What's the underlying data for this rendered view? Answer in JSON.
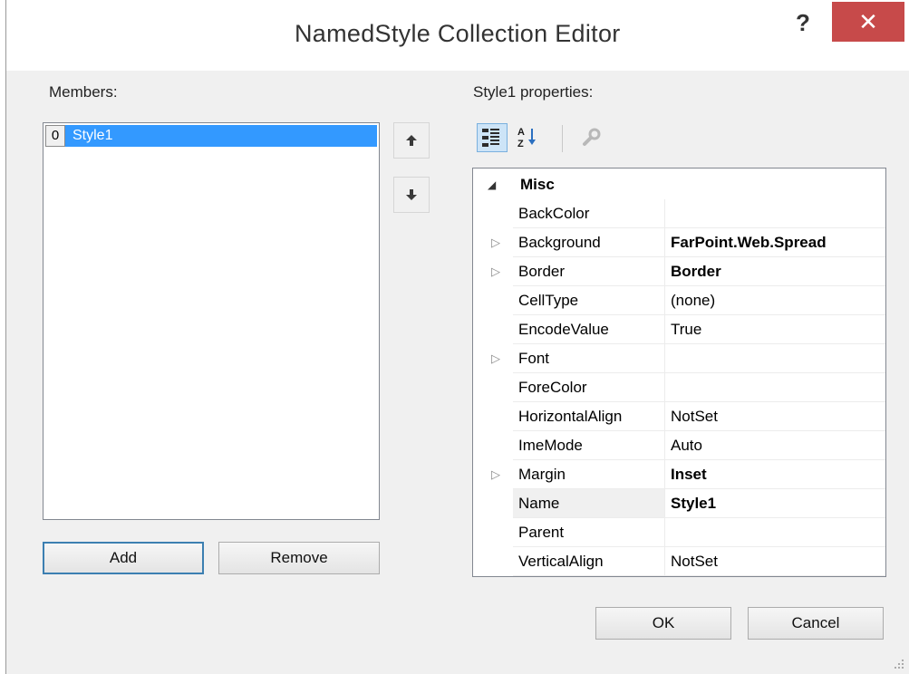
{
  "window": {
    "title": "NamedStyle Collection Editor",
    "help_label": "?",
    "close_label": "✕"
  },
  "members": {
    "label": "Members:",
    "items": [
      {
        "index": "0",
        "name": "Style1"
      }
    ],
    "add_label": "Add",
    "remove_label": "Remove",
    "move_up_icon": "arrow-up-icon",
    "move_down_icon": "arrow-down-icon"
  },
  "properties": {
    "label": "Style1 properties:",
    "toolbar": [
      "categorized-icon",
      "alphabetical-icon",
      "property-pages-icon"
    ],
    "category": "Misc",
    "rows": [
      {
        "name": "BackColor",
        "value": "",
        "bold": false,
        "expandable": false
      },
      {
        "name": "Background",
        "value": "FarPoint.Web.Spread",
        "bold": true,
        "expandable": true
      },
      {
        "name": "Border",
        "value": "Border",
        "bold": true,
        "expandable": true
      },
      {
        "name": "CellType",
        "value": "(none)",
        "bold": false,
        "expandable": false
      },
      {
        "name": "EncodeValue",
        "value": "True",
        "bold": false,
        "expandable": false
      },
      {
        "name": "Font",
        "value": "",
        "bold": false,
        "expandable": true
      },
      {
        "name": "ForeColor",
        "value": "",
        "bold": false,
        "expandable": false
      },
      {
        "name": "HorizontalAlign",
        "value": "NotSet",
        "bold": false,
        "expandable": false
      },
      {
        "name": "ImeMode",
        "value": "Auto",
        "bold": false,
        "expandable": false
      },
      {
        "name": "Margin",
        "value": "Inset",
        "bold": true,
        "expandable": true
      },
      {
        "name": "Name",
        "value": "Style1",
        "bold": true,
        "expandable": false,
        "selected": true
      },
      {
        "name": "Parent",
        "value": "",
        "bold": false,
        "expandable": false
      },
      {
        "name": "VerticalAlign",
        "value": "NotSet",
        "bold": false,
        "expandable": false
      }
    ]
  },
  "footer": {
    "ok_label": "OK",
    "cancel_label": "Cancel"
  },
  "colors": {
    "close_button": "#c74a4a",
    "selection": "#3399ff",
    "dialog_background": "#f0f0f0",
    "default_button_border": "#3c7fb1"
  }
}
